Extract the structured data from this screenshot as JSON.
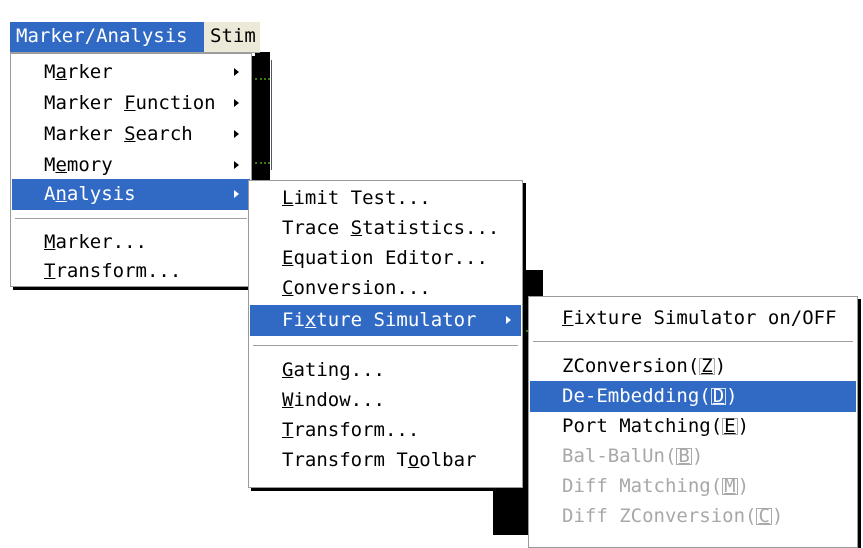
{
  "menubar": {
    "items": [
      {
        "label_parts": [
          {
            "u": "M"
          },
          {
            "t": "arker/Analysis"
          }
        ]
      },
      {
        "label_parts": [
          {
            "u": "S"
          },
          {
            "t": "tim"
          }
        ]
      }
    ]
  },
  "menu1": {
    "items": [
      {
        "label_parts": [
          {
            "t": "M"
          },
          {
            "u": "a"
          },
          {
            "t": "rker"
          }
        ],
        "submenu": true
      },
      {
        "label_parts": [
          {
            "t": "Marker "
          },
          {
            "u": "F"
          },
          {
            "t": "unction"
          }
        ],
        "submenu": true
      },
      {
        "label_parts": [
          {
            "t": "Marker "
          },
          {
            "u": "S"
          },
          {
            "t": "earch"
          }
        ],
        "submenu": true
      },
      {
        "label_parts": [
          {
            "t": "M"
          },
          {
            "u": "e"
          },
          {
            "t": "mory"
          }
        ],
        "submenu": true
      },
      {
        "label_parts": [
          {
            "t": "A"
          },
          {
            "u": "n"
          },
          {
            "t": "alysis"
          }
        ],
        "submenu": true,
        "highlighted": true
      },
      {
        "label_parts": [
          {
            "u": "M"
          },
          {
            "t": "arker..."
          }
        ]
      },
      {
        "label_parts": [
          {
            "u": "T"
          },
          {
            "t": "ransform..."
          }
        ]
      }
    ]
  },
  "menu2": {
    "items": [
      {
        "label_parts": [
          {
            "u": "L"
          },
          {
            "t": "imit Test..."
          }
        ]
      },
      {
        "label_parts": [
          {
            "t": "Trace "
          },
          {
            "u": "S"
          },
          {
            "t": "tatistics..."
          }
        ]
      },
      {
        "label_parts": [
          {
            "u": "E"
          },
          {
            "t": "quation Editor..."
          }
        ]
      },
      {
        "label_parts": [
          {
            "u": "C"
          },
          {
            "t": "onversion..."
          }
        ]
      },
      {
        "label_parts": [
          {
            "t": "Fi"
          },
          {
            "u": "x"
          },
          {
            "t": "ture Simulator"
          }
        ],
        "submenu": true,
        "highlighted": true
      },
      {
        "label_parts": [
          {
            "u": "G"
          },
          {
            "t": "ating..."
          }
        ]
      },
      {
        "label_parts": [
          {
            "u": "W"
          },
          {
            "t": "indow..."
          }
        ]
      },
      {
        "label_parts": [
          {
            "u": "T"
          },
          {
            "t": "ransform..."
          }
        ]
      },
      {
        "label_parts": [
          {
            "t": "Transform T"
          },
          {
            "u": "o"
          },
          {
            "t": "olbar"
          }
        ]
      }
    ]
  },
  "menu3": {
    "items": [
      {
        "label_parts": [
          {
            "u": "F"
          },
          {
            "t": "ixture Simulator on/OFF"
          }
        ]
      },
      {
        "label_parts": [
          {
            "t": "ZConversion("
          },
          {
            "b": "Z"
          },
          {
            "t": ")"
          }
        ]
      },
      {
        "label_parts": [
          {
            "t": "De-Embedding("
          },
          {
            "b": "D"
          },
          {
            "t": ")"
          }
        ],
        "highlighted": true
      },
      {
        "label_parts": [
          {
            "t": "Port Matching("
          },
          {
            "b": "E"
          },
          {
            "t": ")"
          }
        ]
      },
      {
        "label_parts": [
          {
            "t": "Bal-BalUn("
          },
          {
            "b": "B"
          },
          {
            "t": ")"
          }
        ],
        "disabled": true
      },
      {
        "label_parts": [
          {
            "t": "Diff Matching("
          },
          {
            "b": "M"
          },
          {
            "t": ")"
          }
        ],
        "disabled": true
      },
      {
        "label_parts": [
          {
            "t": "Diff ZConversion("
          },
          {
            "b": "C"
          },
          {
            "t": ")"
          }
        ],
        "disabled": true
      }
    ]
  },
  "colors": {
    "highlight": "#316ac5",
    "disabled_text": "#a8a8a8",
    "trace_window": "#000000",
    "trace_green": "#3a7a18",
    "trace_yellow": "#c8c000"
  }
}
